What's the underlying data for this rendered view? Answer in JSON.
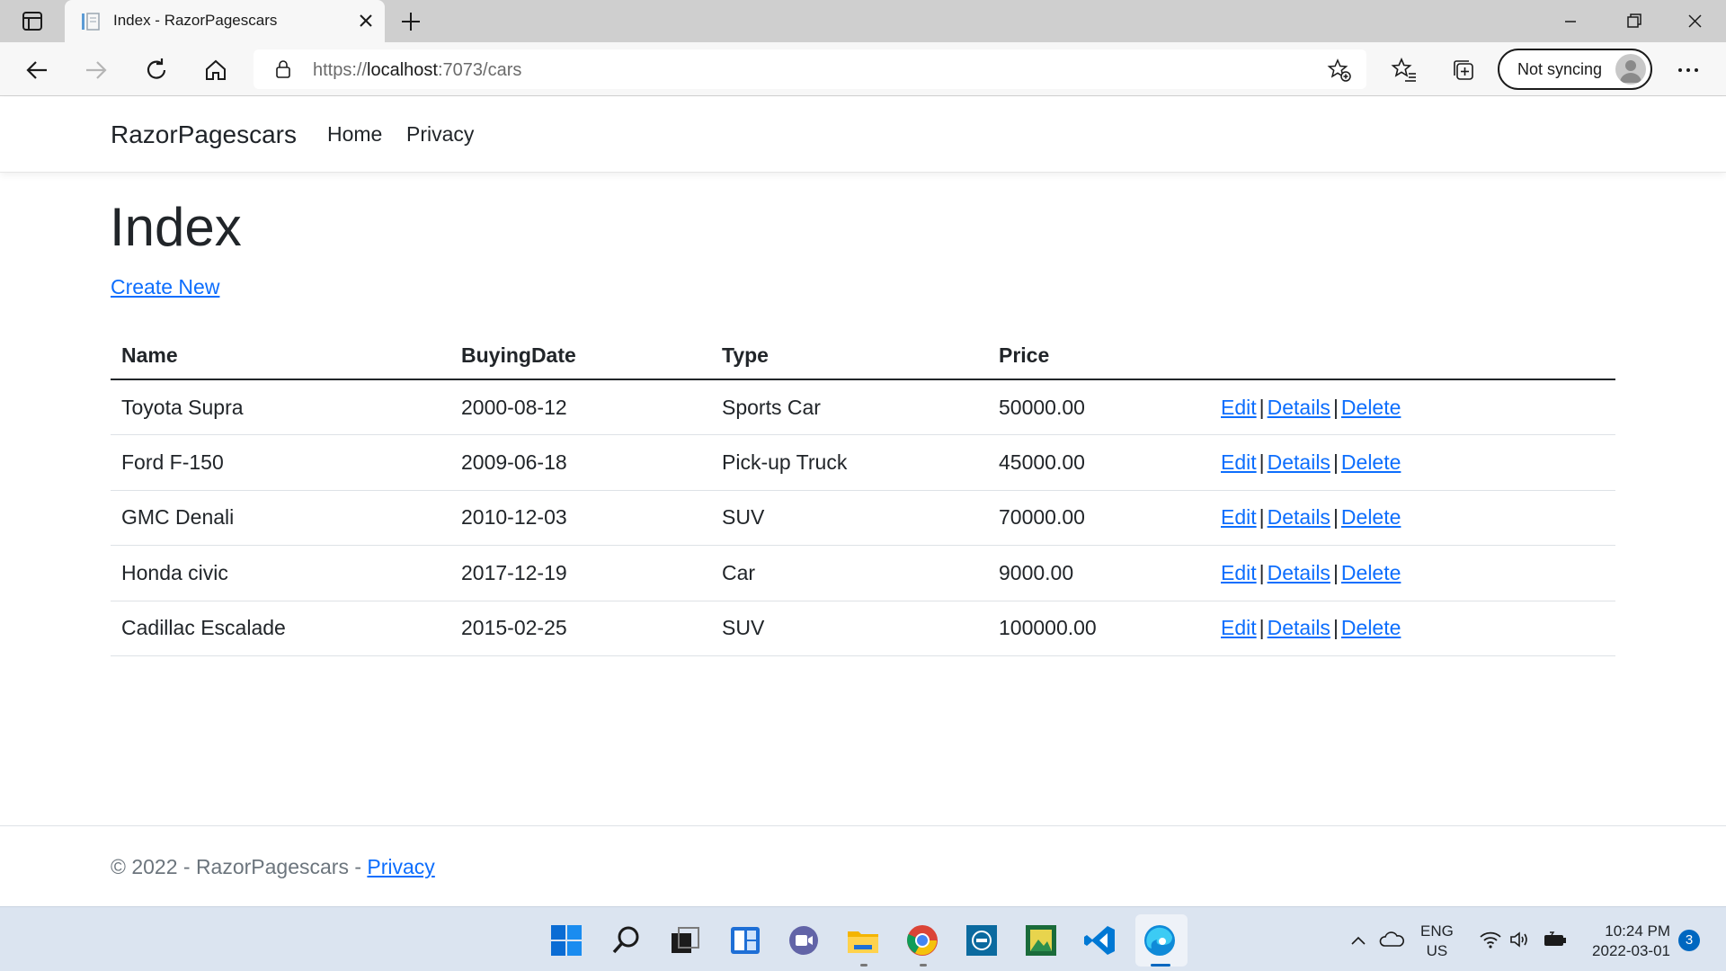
{
  "browser": {
    "tab_title": "Index - RazorPagescars",
    "url_prefix": "https://",
    "url_host": "localhost",
    "url_rest": ":7073/cars",
    "sync_label": "Not syncing"
  },
  "navbar": {
    "brand": "RazorPagescars",
    "links": [
      "Home",
      "Privacy"
    ]
  },
  "main": {
    "title": "Index",
    "create_link": "Create New",
    "table": {
      "headers": [
        "Name",
        "BuyingDate",
        "Type",
        "Price"
      ],
      "rows": [
        {
          "name": "Toyota Supra",
          "date": "2000-08-12",
          "type": "Sports Car",
          "price": "50000.00"
        },
        {
          "name": "Ford F-150",
          "date": "2009-06-18",
          "type": "Pick-up Truck",
          "price": "45000.00"
        },
        {
          "name": "GMC Denali",
          "date": "2010-12-03",
          "type": "SUV",
          "price": "70000.00"
        },
        {
          "name": "Honda civic",
          "date": "2017-12-19",
          "type": "Car",
          "price": "9000.00"
        },
        {
          "name": "Cadillac Escalade",
          "date": "2015-02-25",
          "type": "SUV",
          "price": "100000.00"
        }
      ],
      "actions": {
        "edit": "Edit",
        "details": "Details",
        "delete": "Delete",
        "separator": "|"
      }
    }
  },
  "footer": {
    "text": "© 2022 - RazorPagescars - ",
    "link": "Privacy"
  },
  "taskbar": {
    "lang_line1": "ENG",
    "lang_line2": "US",
    "time": "10:24 PM",
    "date": "2022-03-01",
    "notification_count": "3",
    "icons": [
      "start-icon",
      "search-icon",
      "task-view-icon",
      "widgets-icon",
      "teams-chat-icon",
      "file-explorer-icon",
      "chrome-icon",
      "dell-icon",
      "image-app-icon",
      "vscode-icon",
      "edge-icon"
    ]
  },
  "colors": {
    "link": "#0d6efd",
    "text": "#212529",
    "muted": "#6c757d",
    "taskbar": "#dbe4f0"
  }
}
